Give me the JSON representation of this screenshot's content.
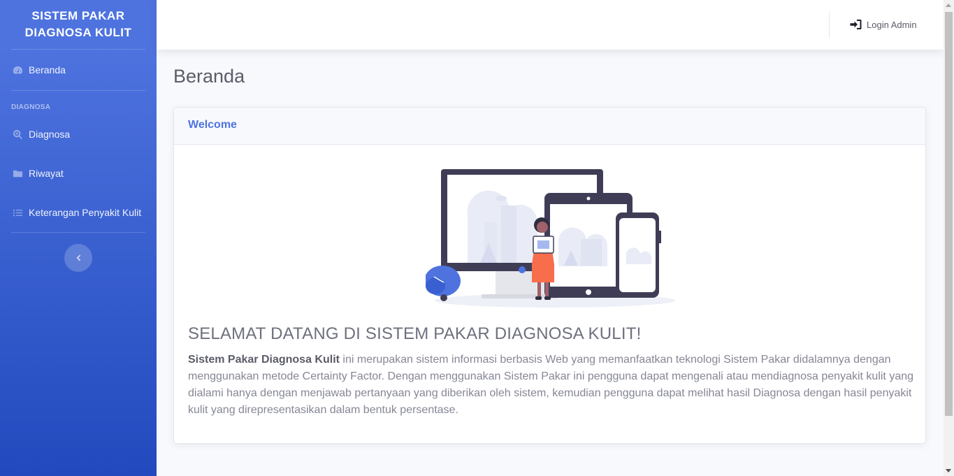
{
  "sidebar": {
    "brand_line1": "SISTEM PAKAR",
    "brand_line2": "DIAGNOSA KULIT",
    "items": [
      {
        "label": "Beranda",
        "icon": "tachometer-icon"
      },
      {
        "label": "Diagnosa",
        "icon": "search-plus-icon"
      },
      {
        "label": "Riwayat",
        "icon": "folder-icon"
      },
      {
        "label": "Keterangan Penyakit Kulit",
        "icon": "list-icon"
      }
    ],
    "heading": "DIAGNOSA",
    "toggle_icon": "chevron-left-icon"
  },
  "topbar": {
    "login_label": "Login Admin",
    "login_icon": "sign-in-icon"
  },
  "page": {
    "title": "Beranda"
  },
  "card": {
    "header": "Welcome",
    "headline": "SELAMAT DATANG DI SISTEM PAKAR DIAGNOSA KULIT!",
    "desc_bold": "Sistem Pakar Diagnosa Kulit",
    "desc_rest": " ini merupakan sistem informasi berbasis Web yang memanfaatkan teknologi Sistem Pakar didalamnya dengan menggunakan metode Certainty Factor. Dengan menggunakan Sistem Pakar ini pengguna dapat mengenali atau mendiagnosa penyakit kulit yang dialami hanya dengan menjawab pertanyaan yang diberikan oleh sistem, kemudian pengguna dapat melihat hasil Diagnosa dengan hasil penyakit kulit yang direpresentasikan dalam bentuk persentase."
  },
  "colors": {
    "primary": "#4e73df",
    "primary_dark": "#224abe",
    "text": "#858796"
  }
}
